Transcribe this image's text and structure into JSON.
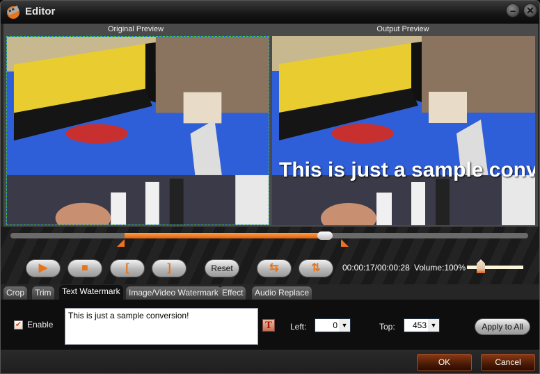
{
  "window": {
    "title": "Editor",
    "minimize_label": "–",
    "close_label": "✕"
  },
  "preview": {
    "original_label": "Original Preview",
    "output_label": "Output Preview",
    "watermark_overlay": "This is just a sample conversion!"
  },
  "timeline": {
    "progress_fraction": 0.607,
    "trim_start_fraction": 0.22,
    "trim_end_fraction": 0.647
  },
  "playback": {
    "play_icon": "▶",
    "stop_icon": "■",
    "mark_in_icon": "[",
    "mark_out_icon": "]",
    "reset_label": "Reset",
    "flip_horizontal_icon": "⇆",
    "flip_vertical_icon": "⇅",
    "time_display": "00:00:17/00:00:28",
    "volume_label": "Volume:100%",
    "volume_percent": 100
  },
  "tabs": [
    {
      "label": "Crop",
      "active": false
    },
    {
      "label": "Trim",
      "active": false
    },
    {
      "label": "Text Watermark",
      "active": true
    },
    {
      "label": "Image/Video Watermark",
      "active": false
    },
    {
      "label": "Effect",
      "active": false
    },
    {
      "label": "Audio Replace",
      "active": false
    }
  ],
  "text_watermark": {
    "enable_label": "Enable",
    "enable_checked": true,
    "text_value": "This is just a sample conversion!",
    "font_button_label": "T",
    "left_label": "Left:",
    "left_value": "0",
    "top_label": "Top:",
    "top_value": "453",
    "apply_all_label": "Apply to All"
  },
  "footer": {
    "ok_label": "OK",
    "cancel_label": "Cancel"
  },
  "colors": {
    "accent_orange": "#f07020",
    "dialog_button": "#5a2008"
  }
}
